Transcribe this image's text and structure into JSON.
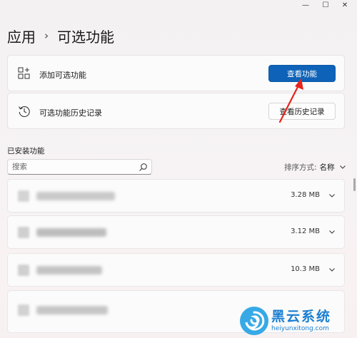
{
  "window": {
    "minimize_glyph": "—",
    "maximize_glyph": "☐",
    "close_glyph": "✕"
  },
  "breadcrumb": {
    "parent": "应用",
    "separator": "›",
    "current": "可选功能"
  },
  "add_card": {
    "icon": "add-grid-icon",
    "label": "添加可选功能",
    "button": "查看功能"
  },
  "history_card": {
    "icon": "history-icon",
    "label": "可选功能历史记录",
    "button": "查看历史记录"
  },
  "installed": {
    "heading": "已安装功能",
    "search_placeholder": "搜索",
    "sort_label": "排序方式:",
    "sort_value": "名称",
    "items": [
      {
        "name": "(blurred)",
        "size": "3.28 MB"
      },
      {
        "name": "(blurred)",
        "size": "3.12 MB"
      },
      {
        "name": "(blurred)",
        "size": "10.3 MB"
      },
      {
        "name": "(blurred)",
        "size": ""
      }
    ]
  },
  "watermark": {
    "title": "黑云系统",
    "url": "heiyunxitong.com"
  },
  "colors": {
    "accent": "#0e63b8",
    "annotation_arrow": "#e8231b",
    "watermark": "#1c7fd1"
  }
}
